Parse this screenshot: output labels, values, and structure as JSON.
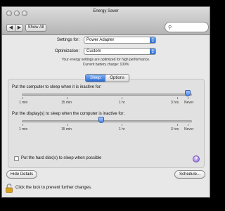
{
  "window": {
    "title": "Energy Saver",
    "nav": {
      "back_icon": "◀",
      "forward_icon": "▶"
    },
    "show_all_label": "Show All",
    "search": {
      "icon": "search-icon",
      "value": "",
      "placeholder": ""
    }
  },
  "settings_for": {
    "label": "Settings for:",
    "value": "Power Adapter"
  },
  "optimization": {
    "label": "Optimization:",
    "value": "Custom"
  },
  "status": {
    "line1": "Your energy settings are optimized for high performance.",
    "line2": "Current battery charge: 100%"
  },
  "tabs": [
    {
      "label": "Sleep",
      "selected": true
    },
    {
      "label": "Options",
      "selected": false
    }
  ],
  "computer_sleep": {
    "label": "Put the computer to sleep when it is inactive for:",
    "value": "Never",
    "ticks": [
      "1 min",
      "15 min",
      "1 hr",
      "3 hrs",
      "Never"
    ]
  },
  "display_sleep": {
    "label": "Put the display(s) to sleep when the computer is inactive for:",
    "value": "1 hr",
    "ticks": [
      "1 min",
      "15 min",
      "1 hr",
      "3 hrs",
      "Never"
    ]
  },
  "hard_disk_sleep": {
    "label": "Put the hard disk(s) to sleep when possible",
    "checked": false
  },
  "help_label": "?",
  "hide_details_label": "Hide Details",
  "schedule_label": "Schedule...",
  "lock_text": "Click the lock to prevent further changes.",
  "colors": {
    "accent": "#2d6ed5",
    "lock": "#d9a21a"
  }
}
